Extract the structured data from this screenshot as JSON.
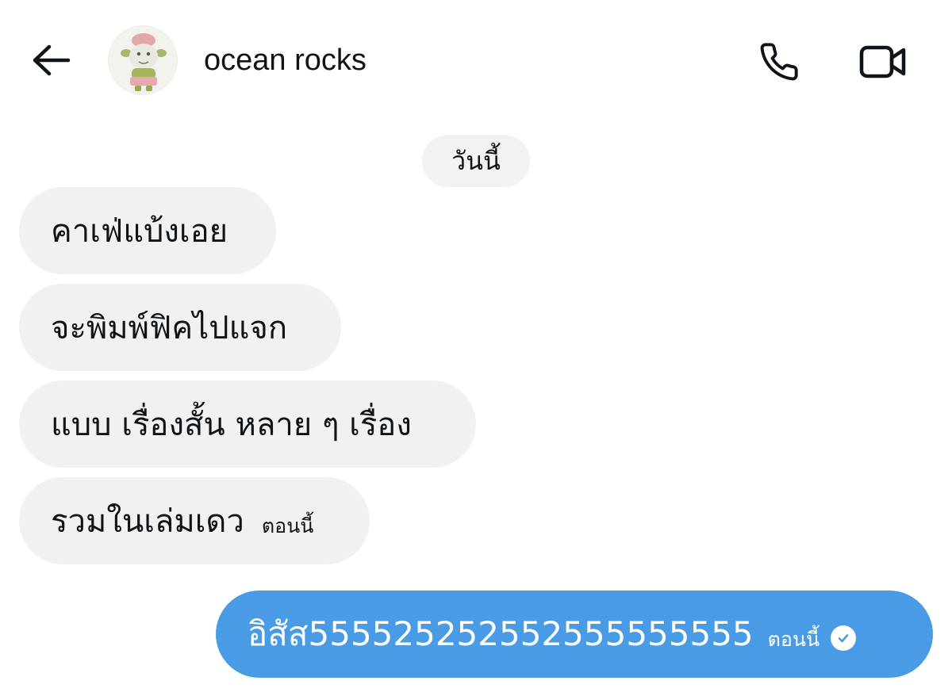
{
  "header": {
    "contact_name": "ocean rocks",
    "back_icon": "arrow-left-icon",
    "call_icon": "phone-icon",
    "video_icon": "video-camera-icon"
  },
  "date_separator": "วันนี้",
  "messages": [
    {
      "direction": "incoming",
      "text": "คาเฟ่แบ้งเอย"
    },
    {
      "direction": "incoming",
      "text": "จะพิมพ์ฟิคไปแจก"
    },
    {
      "direction": "incoming",
      "text": "แบบ เรื่องสั้น หลาย ๆ เรื่อง"
    },
    {
      "direction": "incoming",
      "text": "รวมในเล่มเดว",
      "time": "ตอนนี้"
    },
    {
      "direction": "outgoing",
      "text": "อิสัส555525252552555555555",
      "time": "ตอนนี้",
      "status_icon": "read-check-icon"
    }
  ],
  "colors": {
    "incoming_bubble": "#eff1f2",
    "outgoing_bubble": "#4a9be6",
    "text": "#0f1419"
  }
}
